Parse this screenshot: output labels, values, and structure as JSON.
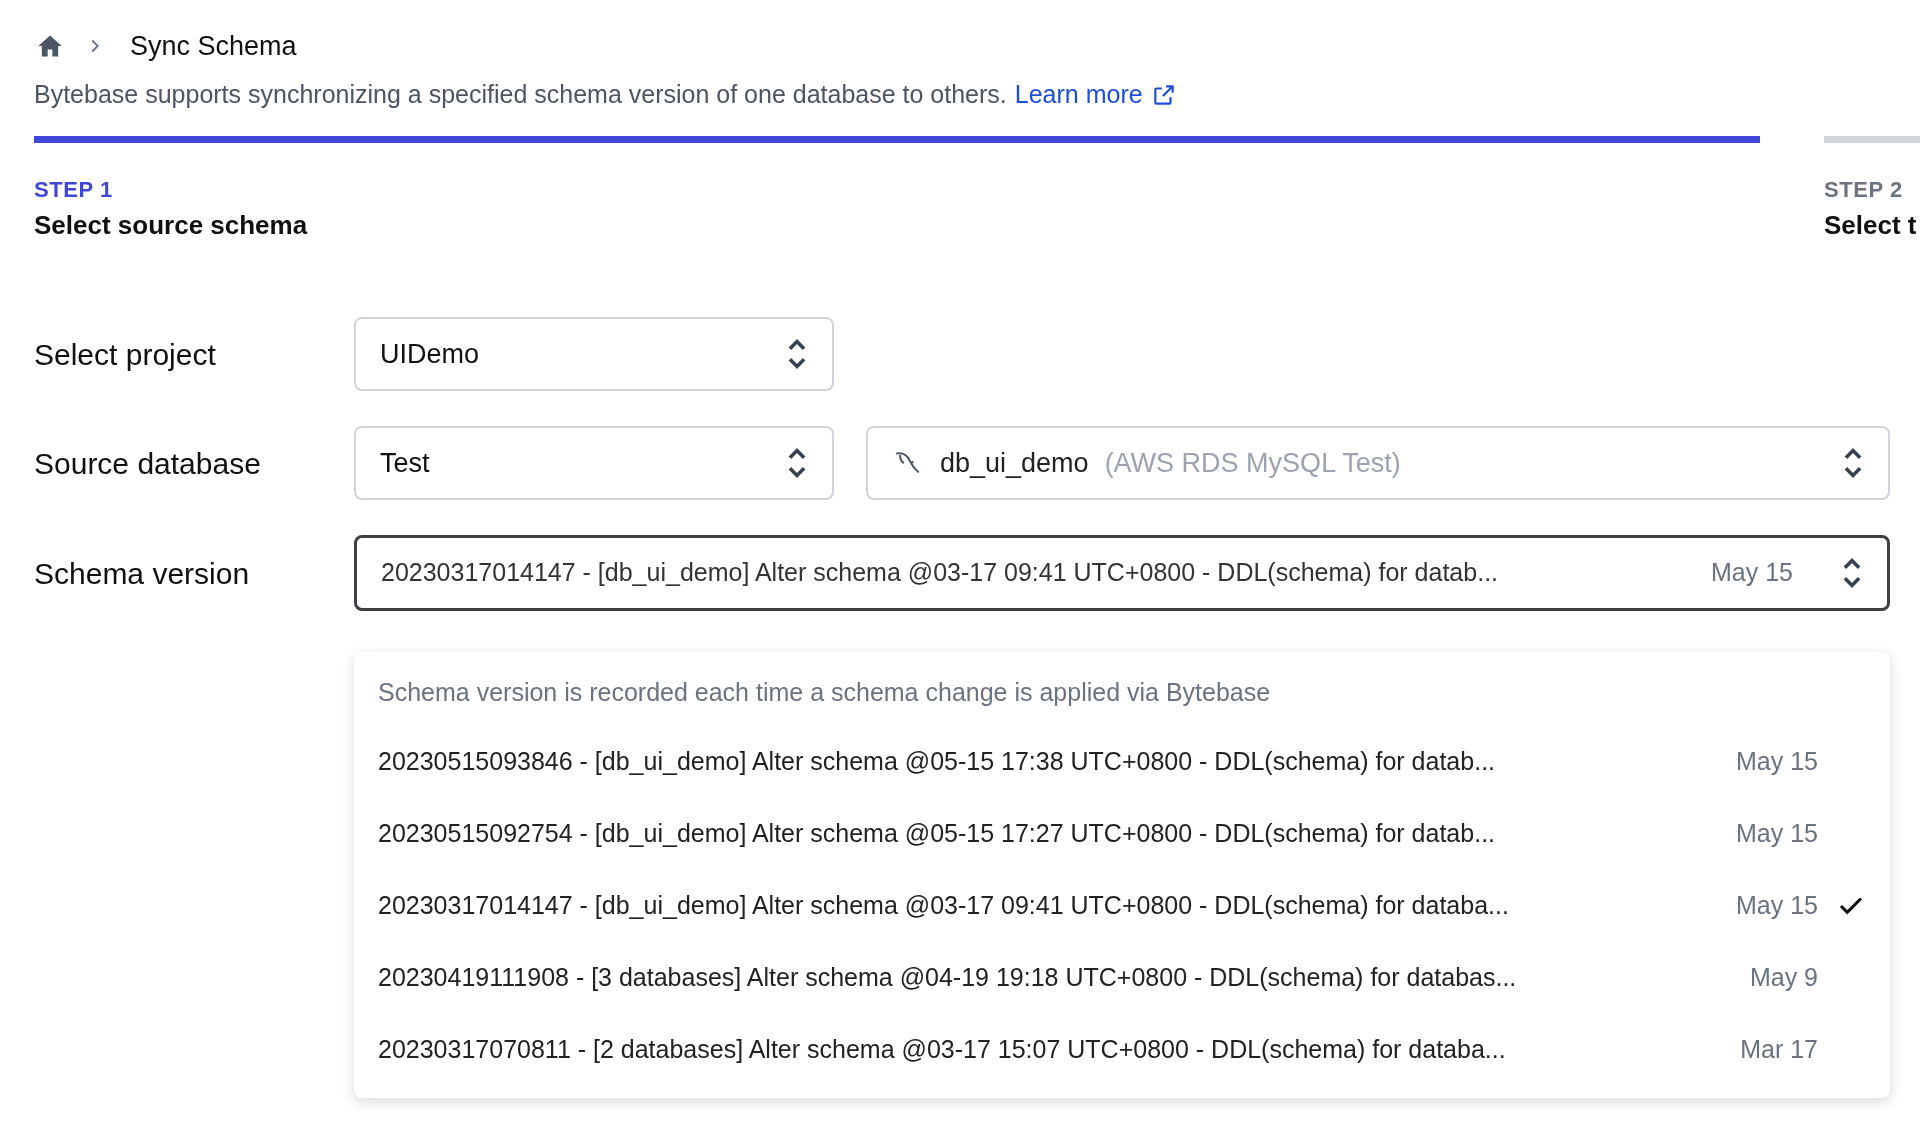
{
  "breadcrumb": {
    "current": "Sync Schema"
  },
  "description": {
    "text": "Bytebase supports synchronizing a specified schema version of one database to others.",
    "link": "Learn more"
  },
  "steps": [
    {
      "label": "STEP 1",
      "title": "Select source schema",
      "selected": true
    },
    {
      "label": "STEP 2",
      "title": "Select t",
      "selected": false
    }
  ],
  "form": {
    "project": {
      "label": "Select project",
      "value": "UIDemo"
    },
    "source_database": {
      "label": "Source database",
      "environment": "Test",
      "database": "db_ui_demo",
      "instance": "(AWS RDS MySQL Test)"
    },
    "schema_version": {
      "label": "Schema version",
      "value": "20230317014147 - [db_ui_demo] Alter schema @03-17 09:41 UTC+0800 - DDL(schema) for datab...",
      "date": "May 15",
      "expanded": true
    }
  },
  "dropdown": {
    "hint": "Schema version is recorded each time a schema change is applied via Bytebase",
    "options": [
      {
        "text": "20230515093846 - [db_ui_demo] Alter schema @05-15 17:38 UTC+0800 - DDL(schema) for datab...",
        "date": "May 15",
        "selected": false
      },
      {
        "text": "20230515092754 - [db_ui_demo] Alter schema @05-15 17:27 UTC+0800 - DDL(schema) for datab...",
        "date": "May 15",
        "selected": false
      },
      {
        "text": "20230317014147 - [db_ui_demo] Alter schema @03-17 09:41 UTC+0800 - DDL(schema) for databa...",
        "date": "May 15",
        "selected": true
      },
      {
        "text": "20230419111908 - [3 databases] Alter schema @04-19 19:18 UTC+0800 - DDL(schema) for databas...",
        "date": "May 9",
        "selected": false
      },
      {
        "text": "20230317070811 - [2 databases] Alter schema @03-17 15:07 UTC+0800 - DDL(schema) for databa...",
        "date": "Mar 17",
        "selected": false
      }
    ]
  }
}
